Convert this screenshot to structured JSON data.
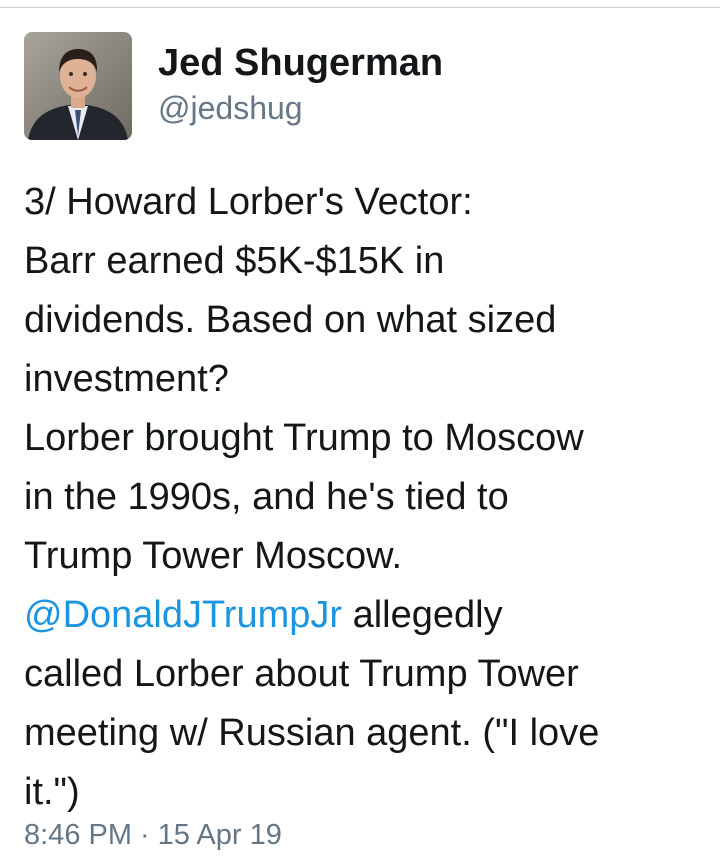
{
  "author": {
    "display_name": "Jed Shugerman",
    "handle": "@jedshug",
    "avatar_icon": "profile-photo"
  },
  "tweet": {
    "lines": [
      {
        "text": "3/ Howard Lorber's Vector:"
      },
      {
        "text": "Barr earned $5K-$15K in"
      },
      {
        "text": "dividends. Based on what sized"
      },
      {
        "text": "investment?"
      },
      {
        "text": "Lorber brought Trump to Moscow"
      },
      {
        "text": "in the 1990s, and he's tied to"
      },
      {
        "text": "Trump Tower Moscow."
      },
      {
        "mention": "@DonaldJTrumpJr",
        "text": " allegedly"
      },
      {
        "text": "called Lorber about Trump Tower"
      },
      {
        "text": "meeting w/ Russian agent. (\"I love"
      },
      {
        "text": "it.\")"
      }
    ],
    "time": "8:46 PM",
    "separator": "·",
    "date": "15 Apr 19"
  },
  "colors": {
    "text": "#14171a",
    "secondary": "#657786",
    "link": "#1b95e0"
  }
}
